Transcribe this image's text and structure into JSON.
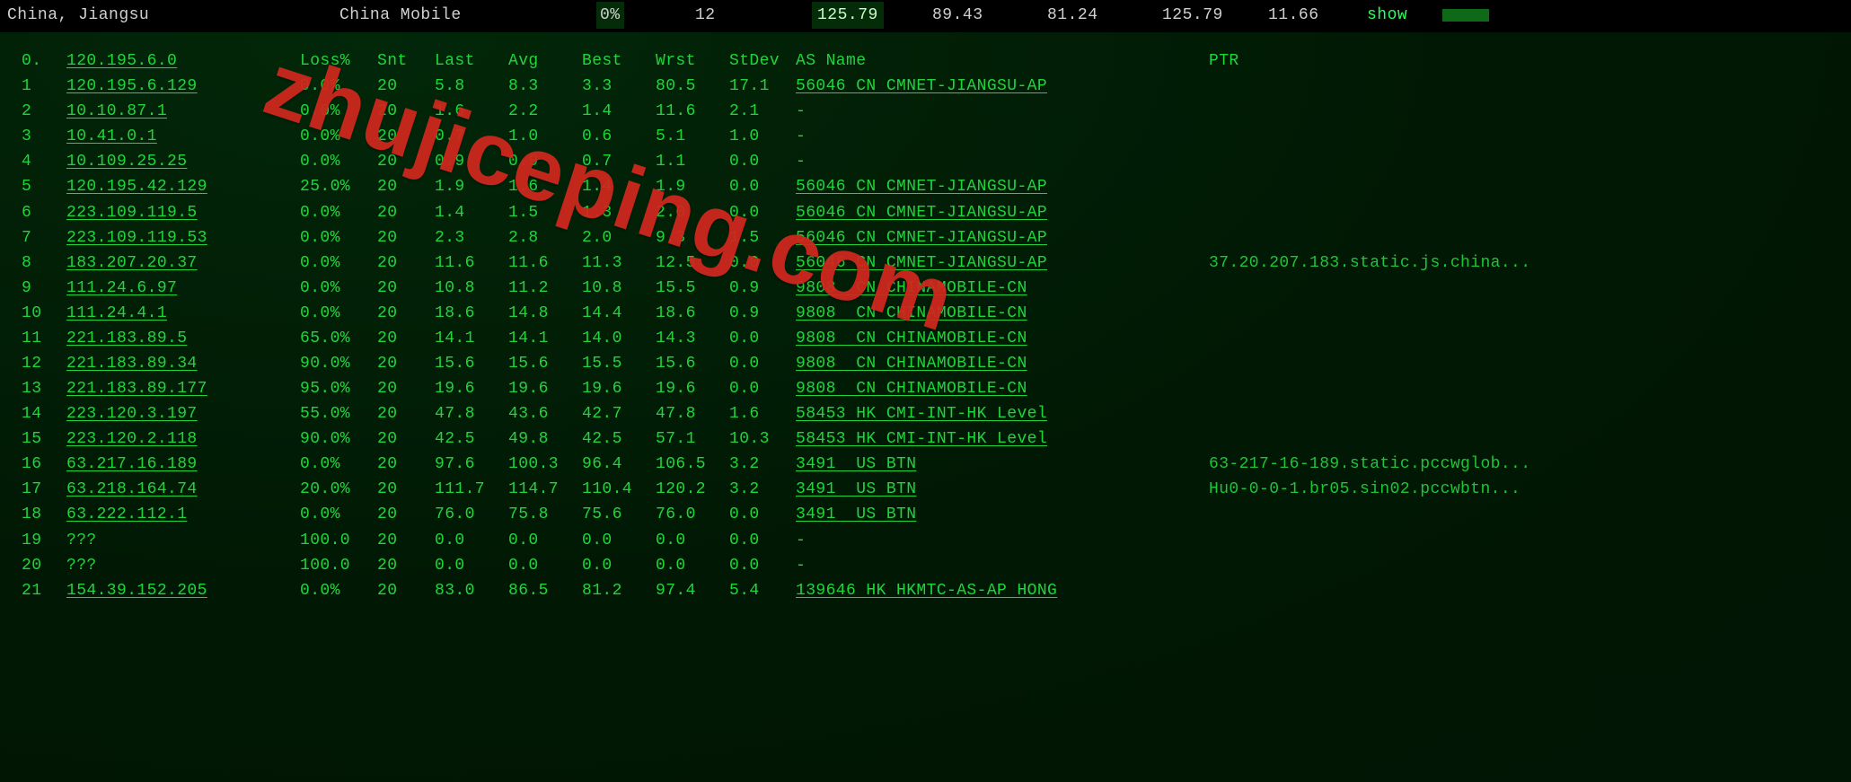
{
  "topbar": {
    "location": "China, Jiangsu",
    "isp": "China Mobile",
    "loss_pct": "0%",
    "hops": "12",
    "last": "125.79",
    "avg": "89.43",
    "best": "81.24",
    "worst": "125.79",
    "stdev": "11.66",
    "action": "show"
  },
  "watermark": "zhujiceping.com",
  "header": {
    "hop": "0.",
    "ip": "120.195.6.0",
    "loss": "Loss%",
    "snt": "Snt",
    "last": "Last",
    "avg": "Avg",
    "best": "Best",
    "wrst": "Wrst",
    "stdev": "StDev",
    "asname": "AS Name",
    "ptr": "PTR"
  },
  "rows": [
    {
      "n": "1",
      "ip": "120.195.6.129",
      "loss": "0.0%",
      "snt": "20",
      "last": "5.8",
      "avg": "8.3",
      "best": "3.3",
      "wrst": "80.5",
      "stdev": "17.1",
      "asname": "56046 CN CMNET-JIANGSU-AP",
      "asname_ul": true,
      "ptr": ""
    },
    {
      "n": "2",
      "ip": "10.10.87.1",
      "loss": "0.0%",
      "snt": "20",
      "last": "1.6",
      "avg": "2.2",
      "best": "1.4",
      "wrst": "11.6",
      "stdev": "2.1",
      "asname": "-",
      "asname_ul": false,
      "ptr": ""
    },
    {
      "n": "3",
      "ip": "10.41.0.1",
      "loss": "0.0%",
      "snt": "20",
      "last": "0.7",
      "avg": "1.0",
      "best": "0.6",
      "wrst": "5.1",
      "stdev": "1.0",
      "asname": "-",
      "asname_ul": false,
      "ptr": ""
    },
    {
      "n": "4",
      "ip": "10.109.25.25",
      "loss": "0.0%",
      "snt": "20",
      "last": "0.9",
      "avg": "0.9",
      "best": "0.7",
      "wrst": "1.1",
      "stdev": "0.0",
      "asname": "-",
      "asname_ul": false,
      "ptr": ""
    },
    {
      "n": "5",
      "ip": "120.195.42.129",
      "loss": "25.0%",
      "snt": "20",
      "last": "1.9",
      "avg": "1.6",
      "best": "1.4",
      "wrst": "1.9",
      "stdev": "0.0",
      "asname": "56046 CN CMNET-JIANGSU-AP",
      "asname_ul": true,
      "ptr": ""
    },
    {
      "n": "6",
      "ip": "223.109.119.5",
      "loss": "0.0%",
      "snt": "20",
      "last": "1.4",
      "avg": "1.5",
      "best": "1.3",
      "wrst": "2.0",
      "stdev": "0.0",
      "asname": "56046 CN CMNET-JIANGSU-AP",
      "asname_ul": true,
      "ptr": ""
    },
    {
      "n": "7",
      "ip": "223.109.119.53",
      "loss": "0.0%",
      "snt": "20",
      "last": "2.3",
      "avg": "2.8",
      "best": "2.0",
      "wrst": "9.3",
      "stdev": "1.5",
      "asname": "56046 CN CMNET-JIANGSU-AP",
      "asname_ul": true,
      "ptr": ""
    },
    {
      "n": "8",
      "ip": "183.207.20.37",
      "loss": "0.0%",
      "snt": "20",
      "last": "11.6",
      "avg": "11.6",
      "best": "11.3",
      "wrst": "12.5",
      "stdev": "0.0",
      "asname": "56046 CN CMNET-JIANGSU-AP",
      "asname_ul": true,
      "ptr": "37.20.207.183.static.js.china..."
    },
    {
      "n": "9",
      "ip": "111.24.6.97",
      "loss": "0.0%",
      "snt": "20",
      "last": "10.8",
      "avg": "11.2",
      "best": "10.8",
      "wrst": "15.5",
      "stdev": "0.9",
      "asname": "9808  CN CHINAMOBILE-CN",
      "asname_ul": true,
      "ptr": ""
    },
    {
      "n": "10",
      "ip": "111.24.4.1",
      "loss": "0.0%",
      "snt": "20",
      "last": "18.6",
      "avg": "14.8",
      "best": "14.4",
      "wrst": "18.6",
      "stdev": "0.9",
      "asname": "9808  CN CHINAMOBILE-CN",
      "asname_ul": true,
      "ptr": ""
    },
    {
      "n": "11",
      "ip": "221.183.89.5",
      "loss": "65.0%",
      "snt": "20",
      "last": "14.1",
      "avg": "14.1",
      "best": "14.0",
      "wrst": "14.3",
      "stdev": "0.0",
      "asname": "9808  CN CHINAMOBILE-CN",
      "asname_ul": true,
      "ptr": ""
    },
    {
      "n": "12",
      "ip": "221.183.89.34",
      "loss": "90.0%",
      "snt": "20",
      "last": "15.6",
      "avg": "15.6",
      "best": "15.5",
      "wrst": "15.6",
      "stdev": "0.0",
      "asname": "9808  CN CHINAMOBILE-CN",
      "asname_ul": true,
      "ptr": ""
    },
    {
      "n": "13",
      "ip": "221.183.89.177",
      "loss": "95.0%",
      "snt": "20",
      "last": "19.6",
      "avg": "19.6",
      "best": "19.6",
      "wrst": "19.6",
      "stdev": "0.0",
      "asname": "9808  CN CHINAMOBILE-CN",
      "asname_ul": true,
      "ptr": ""
    },
    {
      "n": "14",
      "ip": "223.120.3.197",
      "loss": "55.0%",
      "snt": "20",
      "last": "47.8",
      "avg": "43.6",
      "best": "42.7",
      "wrst": "47.8",
      "stdev": "1.6",
      "asname": "58453 HK CMI-INT-HK Level",
      "asname_ul": true,
      "ptr": ""
    },
    {
      "n": "15",
      "ip": "223.120.2.118",
      "loss": "90.0%",
      "snt": "20",
      "last": "42.5",
      "avg": "49.8",
      "best": "42.5",
      "wrst": "57.1",
      "stdev": "10.3",
      "asname": "58453 HK CMI-INT-HK Level",
      "asname_ul": true,
      "ptr": ""
    },
    {
      "n": "16",
      "ip": "63.217.16.189",
      "loss": "0.0%",
      "snt": "20",
      "last": "97.6",
      "avg": "100.3",
      "best": "96.4",
      "wrst": "106.5",
      "stdev": "3.2",
      "asname": "3491  US BTN",
      "asname_ul": true,
      "ptr": "63-217-16-189.static.pccwglob..."
    },
    {
      "n": "17",
      "ip": "63.218.164.74",
      "loss": "20.0%",
      "snt": "20",
      "last": "111.7",
      "avg": "114.7",
      "best": "110.4",
      "wrst": "120.2",
      "stdev": "3.2",
      "asname": "3491  US BTN",
      "asname_ul": true,
      "ptr": "Hu0-0-0-1.br05.sin02.pccwbtn..."
    },
    {
      "n": "18",
      "ip": "63.222.112.1",
      "loss": "0.0%",
      "snt": "20",
      "last": "76.0",
      "avg": "75.8",
      "best": "75.6",
      "wrst": "76.0",
      "stdev": "0.0",
      "asname": "3491  US BTN",
      "asname_ul": true,
      "ptr": ""
    },
    {
      "n": "19",
      "ip": "???",
      "loss": "100.0",
      "snt": "20",
      "last": "0.0",
      "avg": "0.0",
      "best": "0.0",
      "wrst": "0.0",
      "stdev": "0.0",
      "asname": "-",
      "asname_ul": false,
      "ptr": "",
      "ip_ul": false
    },
    {
      "n": "20",
      "ip": "???",
      "loss": "100.0",
      "snt": "20",
      "last": "0.0",
      "avg": "0.0",
      "best": "0.0",
      "wrst": "0.0",
      "stdev": "0.0",
      "asname": "-",
      "asname_ul": false,
      "ptr": "",
      "ip_ul": false
    },
    {
      "n": "21",
      "ip": "154.39.152.205",
      "loss": "0.0%",
      "snt": "20",
      "last": "83.0",
      "avg": "86.5",
      "best": "81.2",
      "wrst": "97.4",
      "stdev": "5.4",
      "asname": "139646 HK HKMTC-AS-AP HONG",
      "asname_ul": true,
      "ptr": ""
    }
  ]
}
